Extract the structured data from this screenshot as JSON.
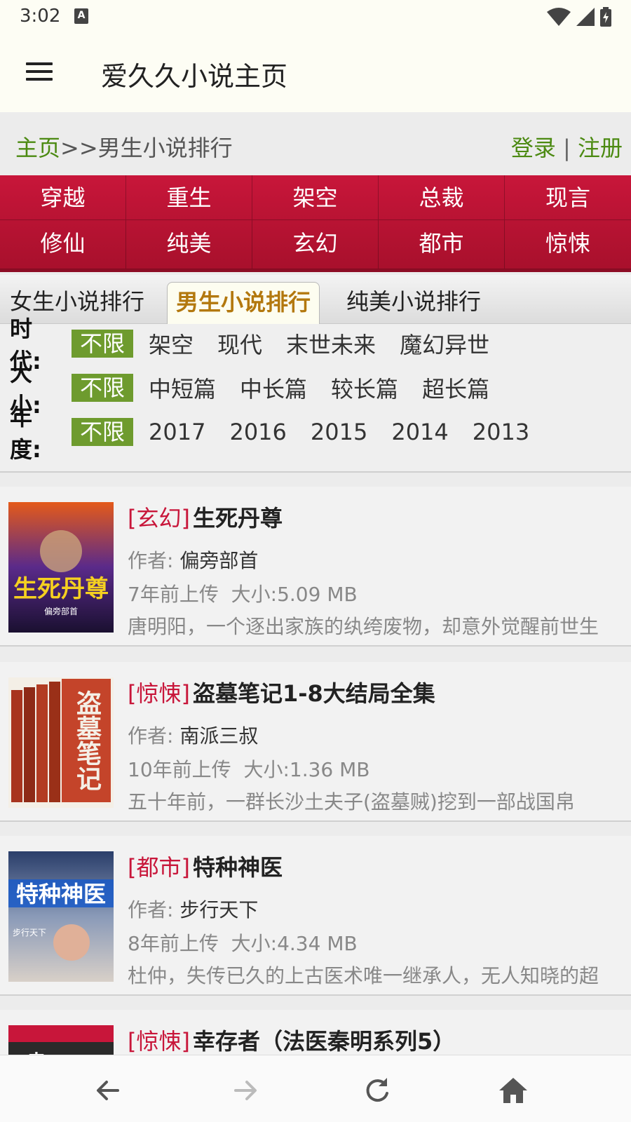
{
  "status": {
    "time": "3:02",
    "a_icon": "A"
  },
  "app": {
    "title": "爱久久小说主页"
  },
  "breadcrumb": {
    "home": "主页",
    "sep": ">>",
    "current": "男生小说排行"
  },
  "auth": {
    "login": "登录",
    "divider": "|",
    "register": "注册"
  },
  "categories": [
    "穿越",
    "重生",
    "架空",
    "总裁",
    "现言",
    "修仙",
    "纯美",
    "玄幻",
    "都市",
    "惊悚"
  ],
  "tabs": [
    {
      "label": "女生小说排行",
      "active": false
    },
    {
      "label": "男生小说排行",
      "active": true
    },
    {
      "label": "纯美小说排行",
      "active": false
    }
  ],
  "filters": [
    {
      "label": "时代:",
      "options": [
        "不限",
        "架空",
        "现代",
        "末世未来",
        "魔幻异世"
      ],
      "selected": 0
    },
    {
      "label": "大小:",
      "options": [
        "不限",
        "中短篇",
        "中长篇",
        "较长篇",
        "超长篇"
      ],
      "selected": 0
    },
    {
      "label": "年度:",
      "options": [
        "不限",
        "2017",
        "2016",
        "2015",
        "2014",
        "2013"
      ],
      "selected": 0
    }
  ],
  "books": [
    {
      "genre": "[玄幻]",
      "title": "生死丹尊",
      "author_label": "作者:",
      "author": "偏旁部首",
      "uploaded": "7年前上传",
      "size": "大小:5.09 MB",
      "desc": "唐明阳，一个逐出家族的纨绔废物，却意外觉醒前世生",
      "cover_text": "生死丹尊",
      "cover_sub": "偏旁部首"
    },
    {
      "genre": "[惊悚]",
      "title": "盗墓笔记1-8大结局全集",
      "author_label": "作者:",
      "author": "南派三叔",
      "uploaded": "10年前上传",
      "size": "大小:1.36 MB",
      "desc": "五十年前，一群长沙土夫子(盗墓贼)挖到一部战国帛",
      "cover_text": "盗墓笔记",
      "cover_sub": ""
    },
    {
      "genre": "[都市]",
      "title": "特种神医",
      "author_label": "作者:",
      "author": "步行天下",
      "uploaded": "8年前上传",
      "size": "大小:4.34 MB",
      "desc": "杜仲，失传已久的上古医术唯一继承人，无人知晓的超",
      "cover_text": "特种神医",
      "cover_sub": "步行天下"
    },
    {
      "genre": "[惊悚]",
      "title": "幸存者（法医秦明系列5）",
      "author_label": "",
      "author": "",
      "uploaded": "",
      "size": "",
      "desc": "",
      "cover_text": "幸",
      "cover_sub": ""
    }
  ],
  "colors": {
    "accent_green": "#6e9b2e",
    "category_red": "#c8163a",
    "tab_active_text": "#b3780e"
  },
  "bottom_nav": [
    "back-icon",
    "forward-icon",
    "refresh-icon",
    "home-icon"
  ]
}
